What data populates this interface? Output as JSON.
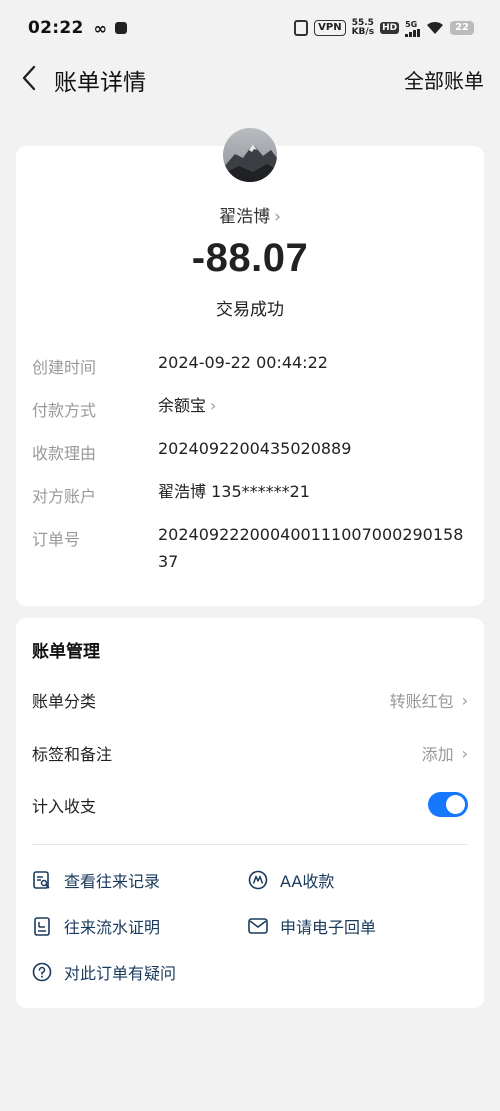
{
  "status_bar": {
    "time": "02:22",
    "infinity": "∞",
    "vpn": "VPN",
    "speed_value": "55.5",
    "speed_unit": "KB/s",
    "hd": "HD",
    "network": "5G",
    "battery": "22"
  },
  "nav": {
    "title": "账单详情",
    "right_link": "全部账单"
  },
  "transaction": {
    "payee": "翟浩博",
    "amount": "-88.07",
    "status": "交易成功"
  },
  "details": [
    {
      "label": "创建时间",
      "value": "2024-09-22 00:44:22"
    },
    {
      "label": "付款方式",
      "value": "余额宝"
    },
    {
      "label": "收款理由",
      "value": "2024092200435020889"
    },
    {
      "label": "对方账户",
      "value": "翟浩博 135******21"
    },
    {
      "label": "订单号",
      "value": "20240922200040011100700029015837"
    }
  ],
  "management": {
    "title": "账单管理",
    "category_label": "账单分类",
    "category_value": "转账红包",
    "tags_label": "标签和备注",
    "tags_value": "添加",
    "count_label": "计入收支",
    "count_enabled": true
  },
  "links": {
    "history": "查看往来记录",
    "aa": "AA收款",
    "flow_proof": "往来流水证明",
    "receipt": "申请电子回单",
    "question": "对此订单有疑问"
  },
  "colors": {
    "accent": "#1677ff",
    "link_text": "#1a3a5c",
    "muted": "#999999"
  }
}
